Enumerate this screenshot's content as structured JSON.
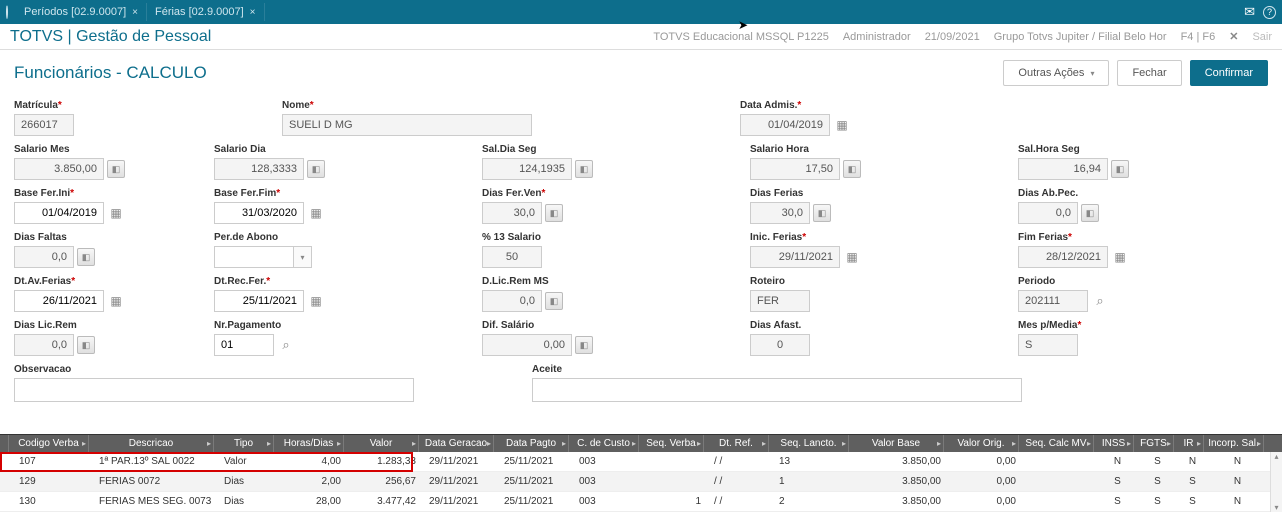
{
  "tabs": [
    {
      "label": "Períodos [02.9.0007]"
    },
    {
      "label": "Férias [02.9.0007]"
    }
  ],
  "brand": "TOTVS | Gestão de Pessoal",
  "info": {
    "env": "TOTVS Educacional MSSQL P1225",
    "user": "Administrador",
    "date": "21/09/2021",
    "group": "Grupo Totvs Jupiter / Filial Belo Hor",
    "shortcut": "F4 | F6",
    "exit": "Sair"
  },
  "page_title": "Funcionários - CALCULO",
  "actions": {
    "other": "Outras Ações",
    "close": "Fechar",
    "confirm": "Confirmar"
  },
  "f": {
    "matricula": {
      "label": "Matrícula",
      "value": "266017"
    },
    "nome": {
      "label": "Nome",
      "value": "SUELI D MG"
    },
    "data_admis": {
      "label": "Data Admis.",
      "value": "01/04/2019"
    },
    "salario_mes": {
      "label": "Salario Mes",
      "value": "3.850,00"
    },
    "salario_dia": {
      "label": "Salario Dia",
      "value": "128,3333"
    },
    "sal_dia_seg": {
      "label": "Sal.Dia Seg",
      "value": "124,1935"
    },
    "salario_hora": {
      "label": "Salario Hora",
      "value": "17,50"
    },
    "sal_hora_seg": {
      "label": "Sal.Hora Seg",
      "value": "16,94"
    },
    "base_fer_ini": {
      "label": "Base Fer.Ini",
      "value": "01/04/2019"
    },
    "base_fer_fim": {
      "label": "Base Fer.Fim",
      "value": "31/03/2020"
    },
    "dias_fer_ven": {
      "label": "Dias Fer.Ven",
      "value": "30,0"
    },
    "dias_ferias": {
      "label": "Dias Ferias",
      "value": "30,0"
    },
    "dias_ab_pec": {
      "label": "Dias Ab.Pec.",
      "value": "0,0"
    },
    "dias_faltas": {
      "label": "Dias Faltas",
      "value": "0,0"
    },
    "per_abono": {
      "label": "Per.de Abono",
      "value": ""
    },
    "p13": {
      "label": "% 13 Salario",
      "value": "50"
    },
    "inic_ferias": {
      "label": "Inic. Ferias",
      "value": "29/11/2021"
    },
    "fim_ferias": {
      "label": "Fim Ferias",
      "value": "28/12/2021"
    },
    "dt_av_ferias": {
      "label": "Dt.Av.Ferias",
      "value": "26/11/2021"
    },
    "dt_rec_fer": {
      "label": "Dt.Rec.Fer.",
      "value": "25/11/2021"
    },
    "d_lic_rem_ms": {
      "label": "D.Lic.Rem MS",
      "value": "0,0"
    },
    "roteiro": {
      "label": "Roteiro",
      "value": "FER"
    },
    "periodo": {
      "label": "Periodo",
      "value": "202111"
    },
    "dias_lic_rem": {
      "label": "Dias Lic.Rem",
      "value": "0,0"
    },
    "nr_pagamento": {
      "label": "Nr.Pagamento",
      "value": "01"
    },
    "dif_salario": {
      "label": "Dif. Salário",
      "value": "0,00"
    },
    "dias_afast": {
      "label": "Dias Afast.",
      "value": "0"
    },
    "mes_p_media": {
      "label": "Mes p/Media",
      "value": "S"
    },
    "observacao": {
      "label": "Observacao"
    },
    "aceite": {
      "label": "Aceite"
    }
  },
  "grid": {
    "headers": [
      "",
      "Codigo Verba",
      "Descricao",
      "Tipo",
      "Horas/Dias",
      "Valor",
      "Data Geracao",
      "Data Pagto",
      "C. de Custo",
      "Seq. Verba",
      "Dt. Ref.",
      "Seq. Lancto.",
      "Valor Base",
      "Valor Orig.",
      "Seq. Calc MV",
      "INSS",
      "FGTS",
      "IR",
      "Incorp. Sal."
    ],
    "rows": [
      {
        "cod": "107",
        "desc": "1ª PAR.13º SAL 0022",
        "tipo": "Valor",
        "hd": "4,00",
        "valor": "1.283,33",
        "ger": "29/11/2021",
        "pag": "25/11/2021",
        "cc": "003",
        "seqv": "",
        "dtref": "/  /",
        "seql": "13",
        "vbase": "3.850,00",
        "vorig": "0,00",
        "scmv": "",
        "inss": "N",
        "fgts": "S",
        "ir": "N",
        "inc": "N"
      },
      {
        "cod": "129",
        "desc": "FERIAS 0072",
        "tipo": "Dias",
        "hd": "2,00",
        "valor": "256,67",
        "ger": "29/11/2021",
        "pag": "25/11/2021",
        "cc": "003",
        "seqv": "",
        "dtref": "/  /",
        "seql": "1",
        "vbase": "3.850,00",
        "vorig": "0,00",
        "scmv": "",
        "inss": "S",
        "fgts": "S",
        "ir": "S",
        "inc": "N"
      },
      {
        "cod": "130",
        "desc": "FERIAS MES SEG. 0073",
        "tipo": "Dias",
        "hd": "28,00",
        "valor": "3.477,42",
        "ger": "29/11/2021",
        "pag": "25/11/2021",
        "cc": "003",
        "seqv": "1",
        "dtref": "/  /",
        "seql": "2",
        "vbase": "3.850,00",
        "vorig": "0,00",
        "scmv": "",
        "inss": "S",
        "fgts": "S",
        "ir": "S",
        "inc": "N"
      }
    ]
  }
}
